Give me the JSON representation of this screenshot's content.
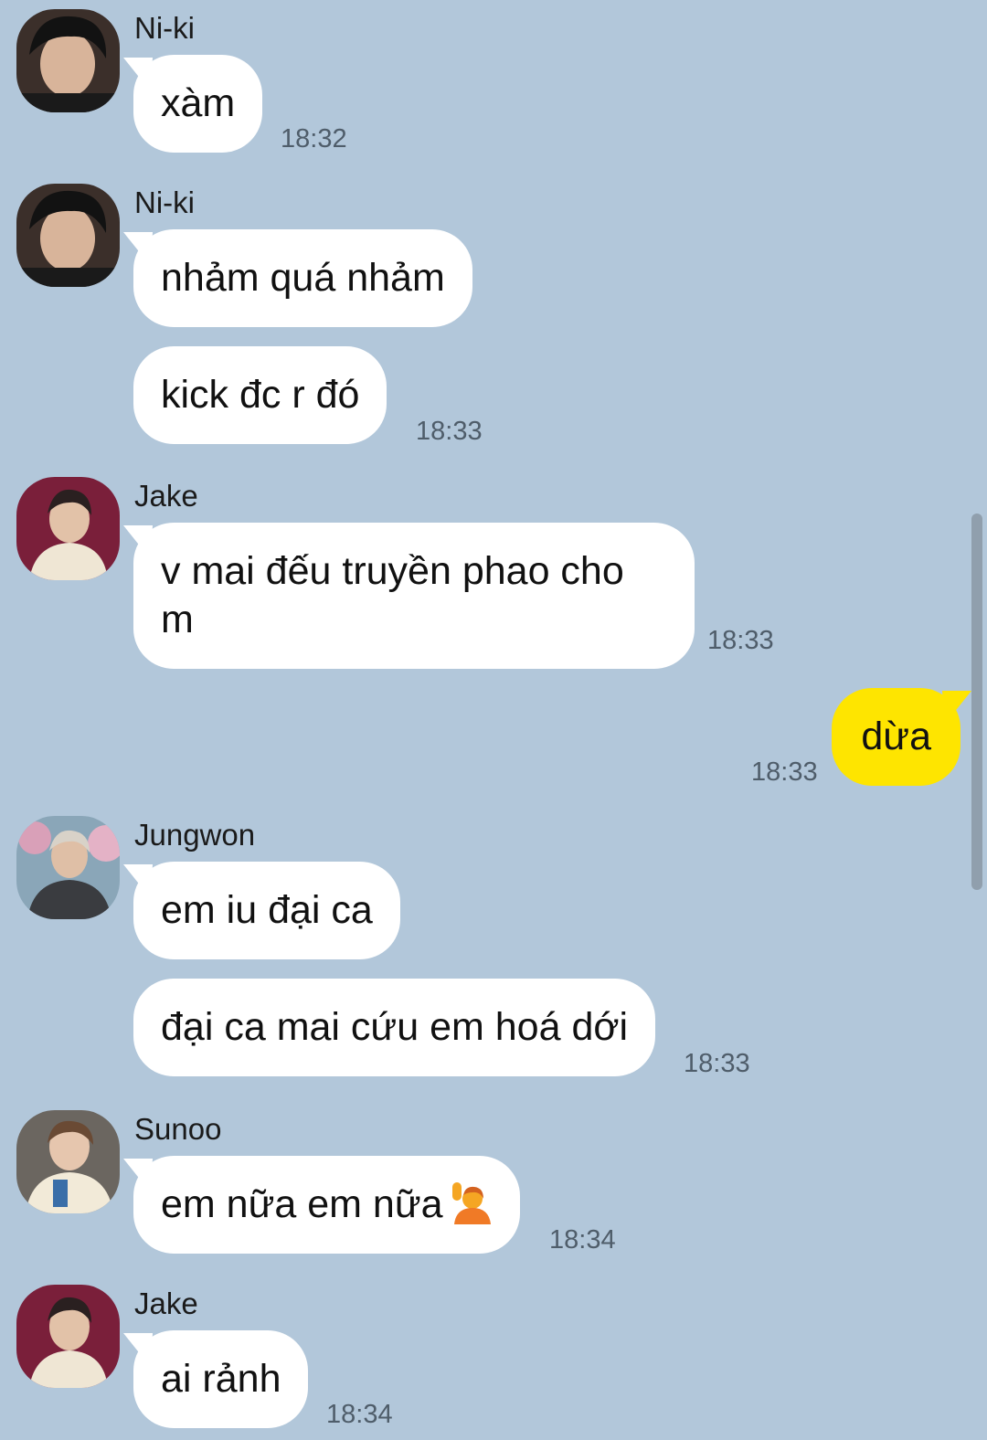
{
  "messages": [
    {
      "sender": "Ni-ki",
      "text": "xàm",
      "time": "18:32"
    },
    {
      "sender": "Ni-ki",
      "text1": "nhảm quá nhảm",
      "text2": "kick đc r đó",
      "time": "18:33"
    },
    {
      "sender": "Jake",
      "text": "v mai đếu truyền phao cho m",
      "time": "18:33"
    },
    {
      "sender": "",
      "text": "dừa",
      "time": "18:33"
    },
    {
      "sender": "Jungwon",
      "text1": "em iu đại ca",
      "text2": "đại ca mai cứu em hoá dới",
      "time": "18:33"
    },
    {
      "sender": "Sunoo",
      "text": "em nữa em nữa",
      "time": "18:34"
    },
    {
      "sender": "Jake",
      "text": "ai rảnh",
      "time": "18:34"
    }
  ],
  "colors": {
    "background": "#b2c7da",
    "my_bubble": "#fee500",
    "other_bubble": "#ffffff"
  },
  "icons": {
    "emoji": "person-raising-hand-emoji"
  }
}
